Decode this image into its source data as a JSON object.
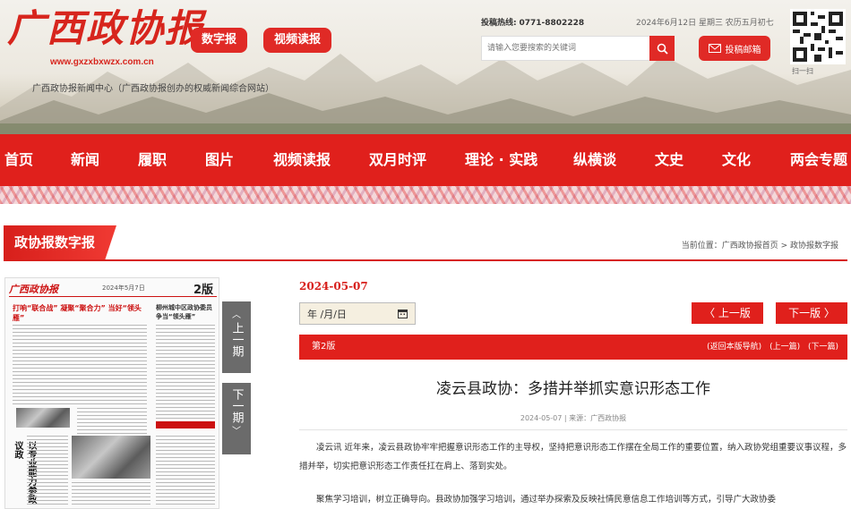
{
  "header": {
    "logo_text": "广西政协报",
    "logo_url": "www.gxzxbxwzx.com.cn",
    "subtitle": "广西政协报新闻中心（广西政协报创办的权威新闻综合网站）",
    "digital_btn": "数字报",
    "video_btn": "视频读报",
    "hotline_label": "投稿热线:",
    "hotline_number": "0771-8802228",
    "date_text": "2024年6月12日 星期三 农历五月初七",
    "search_placeholder": "请输入您要搜索的关键词",
    "submit_btn": "投稿邮箱",
    "qr_caption": "扫一扫"
  },
  "nav": {
    "items": [
      "首页",
      "新闻",
      "履职",
      "图片",
      "视频读报",
      "双月时评",
      "理论 · 实践",
      "纵横谈",
      "文史",
      "文化",
      "两会专题"
    ]
  },
  "section": {
    "tab_label": "政协报数字报",
    "breadcrumb": "当前位置：广西政协报首页 > 政协报数字报"
  },
  "paper": {
    "masthead": "广西政协报",
    "meta": "2024年5月7日",
    "page_no": "2版",
    "headline": "打响“联合战”  凝聚“聚合力”  当好“领头雁”",
    "side_headline": "柳州城中区政协委员争当“领头雁”",
    "block_title": "协商议事",
    "vertical_title": "以专业能力参政议政"
  },
  "flip": {
    "prev": "上一期",
    "next": "下一期"
  },
  "article": {
    "pub_date": "2024-05-07",
    "date_input": "年 /月/日",
    "prev_btn": "〈 上一版",
    "next_btn": "下一版 〉",
    "edition": "第2版",
    "edition_links": [
      "(返回本版导航)",
      "(上一篇)",
      "(下一篇)"
    ],
    "title": "凌云县政协：多措并举抓实意识形态工作",
    "meta": "2024-05-07 | 来源：广西政协报",
    "para1": "凌云讯 近年来，凌云县政协牢牢把握意识形态工作的主导权，坚持把意识形态工作摆在全局工作的重要位置，纳入政协党组重要议事议程，多措并举，切实把意识形态工作责任扛在肩上、落到实处。",
    "para2": "聚焦学习培训，树立正确导向。县政协加强学习培训，通过举办探索及反映社情民意信息工作培训等方式，引导广大政协委"
  },
  "colors": {
    "brand_red": "#e0201c",
    "nav_red": "#e0201c",
    "flip_gray": "#6b6b6b"
  }
}
